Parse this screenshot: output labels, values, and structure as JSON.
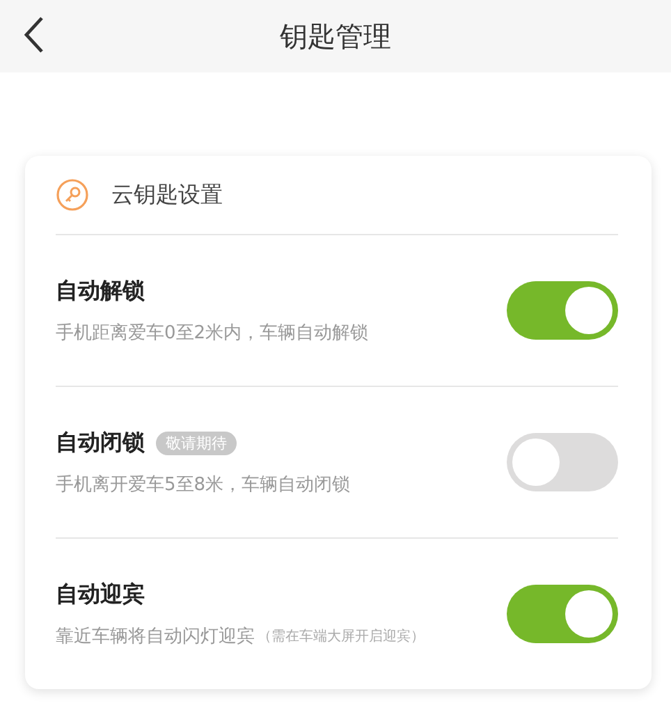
{
  "header": {
    "title": "钥匙管理"
  },
  "card": {
    "title": "云钥匙设置",
    "settings": [
      {
        "title": "自动解锁",
        "description": "手机距离爱车0至2米内，车辆自动解锁",
        "on": true
      },
      {
        "title": "自动闭锁",
        "badge": "敬请期待",
        "description": "手机离开爱车5至8米，车辆自动闭锁",
        "on": false
      },
      {
        "title": "自动迎宾",
        "description": "靠近车辆将自动闪灯迎宾",
        "note": "（需在车端大屏开启迎宾）",
        "on": true
      }
    ]
  }
}
